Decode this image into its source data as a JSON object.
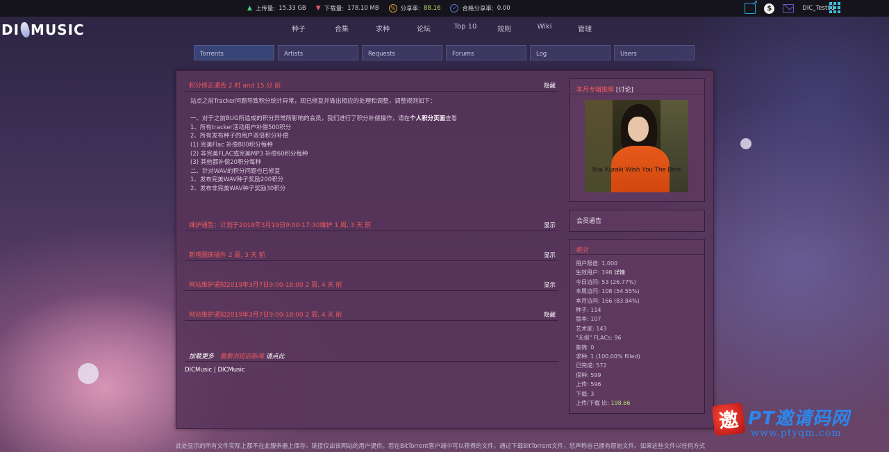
{
  "topbar": {
    "upload_label": "上传量:",
    "upload_value": "15.33 GB",
    "download_label": "下载量:",
    "download_value": "178.10 MB",
    "ratio_label": "分享率:",
    "ratio_value": "88.16",
    "req_ratio_label": "合格分享率:",
    "req_ratio_value": "0.00",
    "username": "DIC_Test01",
    "ratio_icon_glyph": "%",
    "dollar_glyph": "$"
  },
  "logo": {
    "left": "DI",
    "right": "MUSIC"
  },
  "main_nav": [
    "种子",
    "合集",
    "求种",
    "论坛",
    "Top 10",
    "规则",
    "Wiki",
    "管理"
  ],
  "sub_nav": [
    "Torrents",
    "Artists",
    "Requests",
    "Forums",
    "Log",
    "Users"
  ],
  "news": [
    {
      "title": "积分修正通告 2 时 and 15 分 前",
      "toggle": "隐藏",
      "body": {
        "intro": "站点之前Tracker问题导致积分统计异常，现已修复并做出相应的处理和调整，调整规则如下：",
        "line1_pre": "一、对于之前BUG所造成的积分异常所影响的会员，我们进行了积分补偿操作，请在",
        "line1_bold": "个人积分页面",
        "line1_post": "查看",
        "lines": [
          "1、所有tracker活动用户补偿500积分",
          "2、所有发布种子的用户双倍积分补偿",
          "(1) 完美Flac 补偿800积分每种",
          "(2) 非完美FLAC或完美MP3 补偿60积分每种",
          "(3) 其他都补偿20积分每种",
          "二、针对WAV的积分问题也已修复",
          "1、发布完美WAV种子奖励200积分",
          "2、发布非完美WAV种子奖励30积分"
        ]
      }
    },
    {
      "title": "维护通告：计划于2019年3月19日9:00-17:30维护 1 周, 3 天 前",
      "toggle": "显示"
    },
    {
      "title": "新增图床插件 2 周, 3 天 前",
      "toggle": "显示"
    },
    {
      "title": "网站维护通知2019年3月7日9:00-18:00 2 周, 4 天 前",
      "toggle": "显示"
    },
    {
      "title": "网站维护通知2019年3月7日9:00-18:00 2 周, 4 天 前",
      "toggle": "隐藏"
    }
  ],
  "load_more": {
    "pre": "加载更多",
    "mid": "需要浏览旧新闻",
    "post": "请点此"
  },
  "footer_links": "DICMusic | DICMusic",
  "sidebar": {
    "album_box": {
      "title": "本月专辑推荐",
      "discuss": "[讨论]",
      "album_caption": "Mai Kuraki  Wish You The Best"
    },
    "member_notice": {
      "title": "会员通告"
    },
    "stats": {
      "title": "统计",
      "rows": [
        {
          "label": "用户限值: 1,000"
        },
        {
          "label": "生效用户: 198 ",
          "extra": "详情"
        },
        {
          "label": "今日访问: 53 (26.77%)"
        },
        {
          "label": "本周访问: 108 (54.55%)"
        },
        {
          "label": "本月访问: 166 (83.84%)"
        },
        {
          "label": "种子: 114"
        },
        {
          "label": "版本: 107"
        },
        {
          "label": "艺术家: 143"
        },
        {
          "label": "\"无损\" FLACs: 96"
        },
        {
          "label": "集锦: 0"
        },
        {
          "label": "求种: 1 (100.00% filled)"
        },
        {
          "label": "已完成: 572"
        },
        {
          "label": "保种: 599"
        },
        {
          "label": "上传: 596"
        },
        {
          "label": "下载: 3"
        },
        {
          "label": "上传/下载 比: ",
          "green": "198.66"
        }
      ]
    }
  },
  "disclaimer": "此处显示的所有文件实际上都不在此服务器上保存。链接仅由该网站的用户提供。若在BitTorrent客户端中可以获得的文件，通过下载BitTorrent文件，您声称自己拥有原始文件。如果这些文件以任何方式",
  "watermark": {
    "seal": "邀",
    "text": "PT邀请码网",
    "url": "www.ptyqm.com"
  },
  "colors": {
    "news_title": "#f05a5a",
    "accent_green": "#b6e06a",
    "panel": "#58345a"
  }
}
